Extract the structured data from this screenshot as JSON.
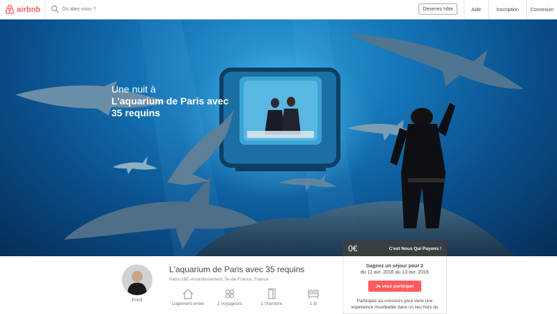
{
  "header": {
    "logo_text": "airbnb",
    "search_placeholder": "Où allez-vous ?",
    "host_button": "Devenez hôte",
    "nav": [
      "Aide",
      "Inscription",
      "Connexion"
    ],
    "brand_color": "#ff5a5f"
  },
  "hero": {
    "title_line1": "Une nuit à",
    "title_line2": "L'aquarium de Paris avec",
    "title_line3": "35 requins"
  },
  "booking": {
    "price": "0€",
    "price_note": "C'est Nous Qui Payons !",
    "title": "Gagnez un séjour pour 2",
    "dates": "du 11 avr. 2016 au 13 avr. 2016",
    "cta": "Je veux participer",
    "desc": "Participez au concours pour vivre une expérience inoubliable dans un lieu hors du"
  },
  "listing": {
    "host_name": "Fred",
    "title": "L'aquarium de Paris avec 35 requins",
    "location": "Paris-16E-Arrondissement, Île-de-France, France",
    "amenities": [
      {
        "icon": "house-icon",
        "label": "Logement entier"
      },
      {
        "icon": "guests-icon",
        "label": "2 voyageurs"
      },
      {
        "icon": "door-icon",
        "label": "1 chambre"
      },
      {
        "icon": "bed-icon",
        "label": "1 lit"
      }
    ]
  }
}
